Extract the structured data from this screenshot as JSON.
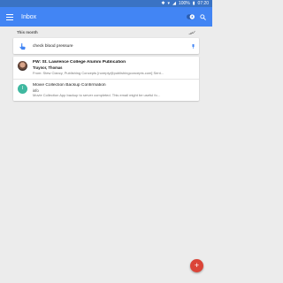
{
  "status_bar": {
    "bluetooth_icon": "bluetooth-icon",
    "wifi_icon": "wifi-icon",
    "signal_icon": "signal-icon",
    "battery": "100%",
    "battery_icon": "battery-icon",
    "time": "07:20"
  },
  "app_bar": {
    "menu_icon": "hamburger-menu-icon",
    "title": "Inbox",
    "pin_toggle_icon": "pin-toggle-icon",
    "search_icon": "search-icon",
    "color": "#4285f4"
  },
  "section": {
    "title": "This month",
    "sweep_icon": "sweep-icon"
  },
  "reminder": {
    "icon": "reminder-hand-icon",
    "text": "check blood pressure",
    "pin_icon": "pin-icon"
  },
  "emails": [
    {
      "avatar": "photo",
      "subject": "FW: St. Lawrence College Alumni Publication",
      "sender": "Traynor, Thomas",
      "snippet": "From: Stew Clancy, Publishing Concepts [noreply@publishingconcepts.com] Sent...",
      "unread": true
    },
    {
      "avatar_letter": "I",
      "avatar_color": "#3fb8a0",
      "subject": "Movie Collection Backup Confirmation",
      "sender": "info",
      "snippet": "Movie Collection App backup to server completed. This email might be useful fo...",
      "unread": false
    }
  ],
  "fab": {
    "label": "+",
    "color": "#db4437"
  }
}
